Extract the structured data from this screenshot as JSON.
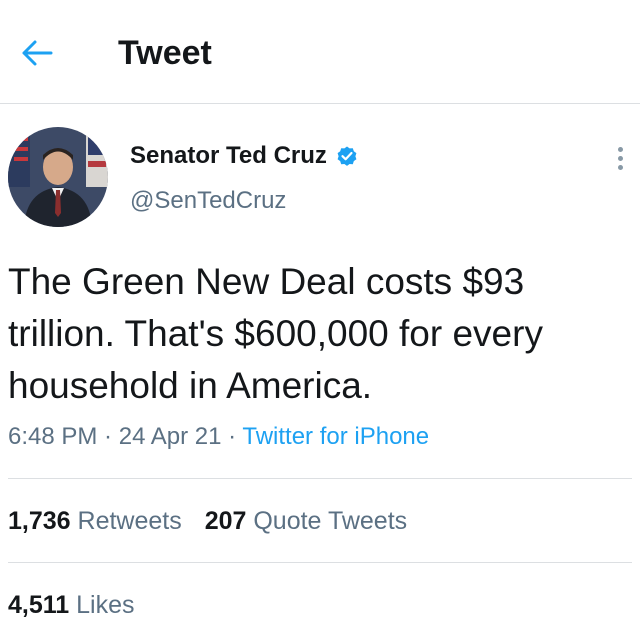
{
  "header": {
    "title": "Tweet",
    "back_icon": "back-arrow-icon"
  },
  "author": {
    "display_name": "Senator Ted Cruz",
    "handle": "@SenTedCruz",
    "verified_icon": "verified-badge-icon"
  },
  "tweet": {
    "text": "The Green New Deal costs $93 trillion. That's $600,000 for every household in America.",
    "time": "6:48 PM",
    "separator": " · ",
    "date": "24 Apr 21",
    "source": "Twitter for iPhone"
  },
  "stats": {
    "retweets_count": "1,736",
    "retweets_label": "Retweets",
    "quote_count": "207",
    "quote_label": "Quote Tweets",
    "likes_count": "4,511",
    "likes_label": "Likes"
  },
  "colors": {
    "accent": "#1da1f2",
    "text": "#14171a",
    "secondary": "#5b7083",
    "divider": "#dcdfe2"
  }
}
